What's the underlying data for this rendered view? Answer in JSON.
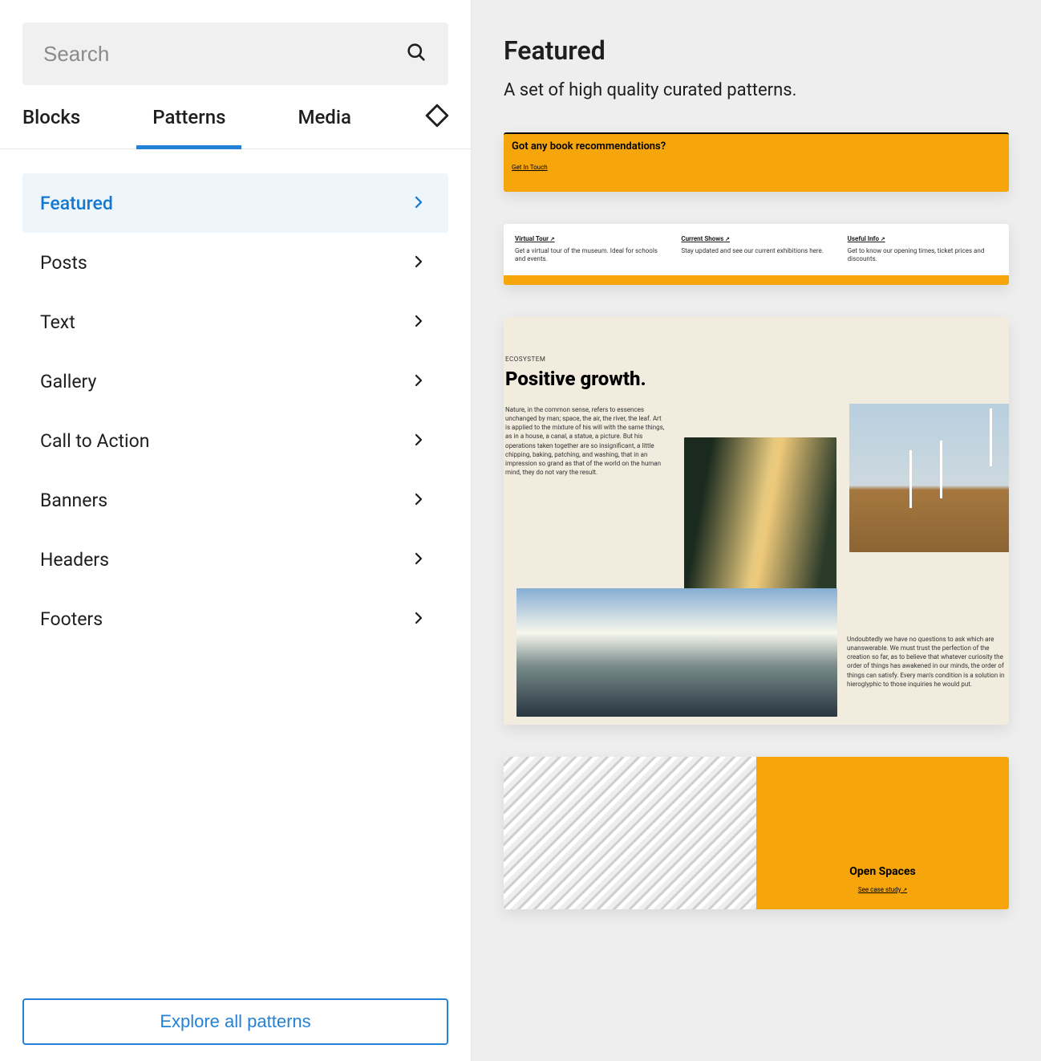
{
  "search": {
    "placeholder": "Search"
  },
  "tabs": {
    "blocks": "Blocks",
    "patterns": "Patterns",
    "media": "Media"
  },
  "categories": [
    {
      "label": "Featured",
      "active": true
    },
    {
      "label": "Posts",
      "active": false
    },
    {
      "label": "Text",
      "active": false
    },
    {
      "label": "Gallery",
      "active": false
    },
    {
      "label": "Call to Action",
      "active": false
    },
    {
      "label": "Banners",
      "active": false
    },
    {
      "label": "Headers",
      "active": false
    },
    {
      "label": "Footers",
      "active": false
    }
  ],
  "explore_label": "Explore all patterns",
  "preview": {
    "title": "Featured",
    "subtitle": "A set of high quality curated patterns.",
    "card1": {
      "heading": "Got any book recommendations?",
      "link": "Get In Touch"
    },
    "card2": {
      "cols": [
        {
          "hdr": "Virtual Tour",
          "txt": "Get a virtual tour of the museum. Ideal for schools and events."
        },
        {
          "hdr": "Current Shows",
          "txt": "Stay updated and see our current exhibitions here."
        },
        {
          "hdr": "Useful Info",
          "txt": "Get to know our opening times, ticket prices and discounts."
        }
      ]
    },
    "card3": {
      "eyebrow": "ECOSYSTEM",
      "headline": "Positive growth.",
      "body1": "Nature, in the common sense, refers to essences unchanged by man; space, the air, the river, the leaf. Art is applied to the mixture of his will with the same things, as in a house, a canal, a statue, a picture. But his operations taken together are so insignificant, a little chipping, baking, patching, and washing, that in an impression so grand as that of the world on the human mind, they do not vary the result.",
      "body2": "Undoubtedly we have no questions to ask which are unanswerable. We must trust the perfection of the creation so far, as to believe that whatever curiosity the order of things has awakened in our minds, the order of things can satisfy. Every man's condition is a solution in hieroglyphic to those inquiries he would put."
    },
    "card4": {
      "title": "Open Spaces",
      "link": "See case study"
    }
  }
}
